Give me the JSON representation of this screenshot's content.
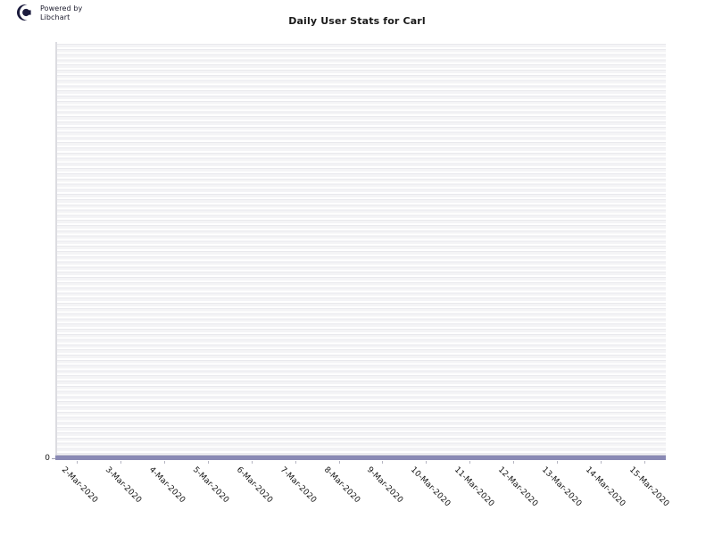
{
  "branding": {
    "logo_icon": "libchart-logo-icon",
    "text": "Powered by\nLibchart"
  },
  "title": "Daily User Stats for Carl",
  "colors": {
    "line": "#8a8ab5",
    "axis": "#c9c9d4",
    "plot_background": "#f2f2f4",
    "gridline": "#e9e9ed",
    "text": "#1a1a1a",
    "logo": "#1c1c3e"
  },
  "chart_data": {
    "type": "line",
    "title": "Daily User Stats for Carl",
    "xlabel": "",
    "ylabel": "",
    "categories": [
      "2-Mar-2020",
      "3-Mar-2020",
      "4-Mar-2020",
      "5-Mar-2020",
      "6-Mar-2020",
      "7-Mar-2020",
      "8-Mar-2020",
      "9-Mar-2020",
      "10-Mar-2020",
      "11-Mar-2020",
      "12-Mar-2020",
      "13-Mar-2020",
      "14-Mar-2020",
      "15-Mar-2020"
    ],
    "values": [
      0,
      0,
      0,
      0,
      0,
      0,
      0,
      0,
      0,
      0,
      0,
      0,
      0,
      0
    ],
    "series": [
      {
        "name": "Daily User Stats for Carl",
        "values": [
          0,
          0,
          0,
          0,
          0,
          0,
          0,
          0,
          0,
          0,
          0,
          0,
          0,
          0
        ]
      }
    ],
    "y_ticks": [
      "0"
    ],
    "ylim": [
      0,
      0
    ],
    "grid": true,
    "legend": "none"
  }
}
